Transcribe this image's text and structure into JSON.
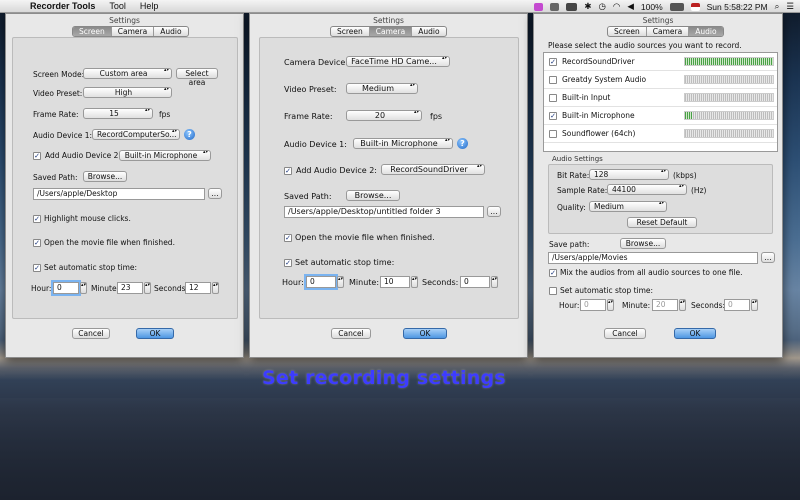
{
  "menubar": {
    "apple": "",
    "app": "Recorder Tools",
    "tool": "Tool",
    "help": "Help",
    "battery": "100%",
    "time": "Sun 5:58:22 PM"
  },
  "caption": "Set recording settings",
  "win1": {
    "title": "Settings",
    "tabs": [
      "Screen",
      "Camera",
      "Audio"
    ],
    "selected_tab": "Screen",
    "screen_mode_label": "Screen Mode:",
    "screen_mode": "Custom area",
    "select_area": "Select area",
    "video_preset_label": "Video Preset:",
    "video_preset": "High",
    "frame_rate_label": "Frame Rate:",
    "frame_rate": "15",
    "fps": "fps",
    "audio1_label": "Audio Device 1:",
    "audio1": "RecordComputerSo...",
    "add_audio2_label": "Add Audio Device 2:",
    "audio2": "Built-in Microphone",
    "saved_path_label": "Saved Path:",
    "browse": "Browse...",
    "path": "/Users/apple/Desktop",
    "dots": "...",
    "highlight": "Highlight mouse clicks.",
    "open_movie": "Open the movie file when finished.",
    "auto_stop": "Set automatic stop time:",
    "hour_label": "Hour:",
    "hour": "0",
    "minute_label": "Minute:",
    "minute": "23",
    "seconds_label": "Seconds:",
    "seconds": "12",
    "cancel": "Cancel",
    "ok": "OK"
  },
  "win2": {
    "title": "Settings",
    "tabs": [
      "Screen",
      "Camera",
      "Audio"
    ],
    "selected_tab": "Camera",
    "camera_device_label": "Camera Device:",
    "camera_device": "FaceTime HD Came...",
    "video_preset_label": "Video Preset:",
    "video_preset": "Medium",
    "frame_rate_label": "Frame Rate:",
    "frame_rate": "20",
    "fps": "fps",
    "audio1_label": "Audio Device 1:",
    "audio1": "Built-in Microphone",
    "add_audio2_label": "Add Audio Device 2:",
    "audio2": "RecordSoundDriver",
    "saved_path_label": "Saved Path:",
    "browse": "Browse...",
    "path": "/Users/apple/Desktop/untitled folder 3",
    "dots": "...",
    "open_movie": "Open the movie file when finished.",
    "auto_stop": "Set automatic stop time:",
    "hour_label": "Hour:",
    "hour": "0",
    "minute_label": "Minute:",
    "minute": "10",
    "seconds_label": "Seconds:",
    "seconds": "0",
    "cancel": "Cancel",
    "ok": "OK"
  },
  "win3": {
    "title": "Settings",
    "tabs": [
      "Screen",
      "Camera",
      "Audio"
    ],
    "selected_tab": "Audio",
    "prompt": "Please select the audio sources you want to record.",
    "sources": [
      {
        "name": "RecordSoundDriver",
        "checked": true,
        "level": 1.0
      },
      {
        "name": "Greatdy System Audio",
        "checked": false,
        "level": 0
      },
      {
        "name": "Built-in Input",
        "checked": false,
        "level": 0
      },
      {
        "name": "Built-in Microphone",
        "checked": true,
        "level": 0.08
      },
      {
        "name": "Soundflower (64ch)",
        "checked": false,
        "level": 0
      }
    ],
    "audio_settings": "Audio Settings",
    "bitrate_label": "Bit Rate:",
    "bitrate": "128",
    "kbps": "(kbps)",
    "samplerate_label": "Sample Rate:",
    "samplerate": "44100",
    "hz": "(Hz)",
    "quality_label": "Quality:",
    "quality": "Medium",
    "reset": "Reset Default",
    "save_path_label": "Save path:",
    "browse": "Browse...",
    "path": "/Users/apple/Movies",
    "dots": "...",
    "mix": "Mix the audios from all audio sources to one file.",
    "auto_stop": "Set automatic stop time:",
    "hour_label": "Hour:",
    "hour": "0",
    "minute_label": "Minute:",
    "minute": "20",
    "seconds_label": "Seconds:",
    "seconds": "0",
    "cancel": "Cancel",
    "ok": "OK"
  }
}
